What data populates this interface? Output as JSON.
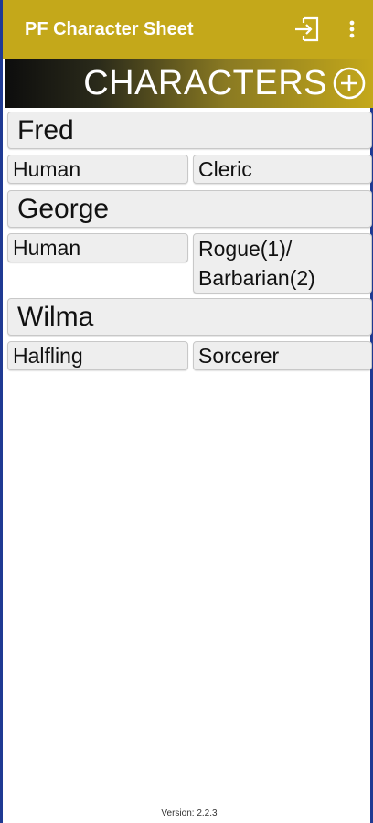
{
  "app_bar": {
    "title": "PF Character Sheet",
    "background": "#c4a81a",
    "icons": [
      "import-icon",
      "more-vert-icon"
    ]
  },
  "header": {
    "title": "CHARACTERS",
    "add_icon": "add-circle-icon"
  },
  "characters": [
    {
      "name": "Fred",
      "race": "Human",
      "class_line1": "Cleric",
      "class_line2": ""
    },
    {
      "name": "George",
      "race": "Human",
      "class_line1": "Rogue(1)/",
      "class_line2": "Barbarian(2)"
    },
    {
      "name": "Wilma",
      "race": "Halfling",
      "class_line1": "Sorcerer",
      "class_line2": ""
    }
  ],
  "footer": {
    "version": "Version: 2.2.3"
  }
}
